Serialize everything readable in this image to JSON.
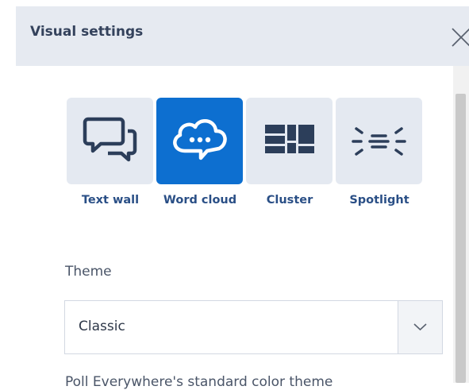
{
  "panel": {
    "title": "Visual settings",
    "close_icon": "close-icon"
  },
  "visual_types": [
    {
      "label": "Text wall",
      "icon": "speech-bubbles-icon",
      "selected": false
    },
    {
      "label": "Word cloud",
      "icon": "cloud-chat-icon",
      "selected": true
    },
    {
      "label": "Cluster",
      "icon": "cluster-blocks-icon",
      "selected": false
    },
    {
      "label": "Spotlight",
      "icon": "spotlight-icon",
      "selected": false
    }
  ],
  "theme": {
    "label": "Theme",
    "selected": "Classic",
    "dropdown_icon": "chevron-down-icon",
    "description": "Poll Everywhere's standard color theme"
  },
  "colors": {
    "accent": "#0d6fd0",
    "tile_bg": "#e4e9f1",
    "header_bg": "#e6eaf1",
    "label_color": "#2a4f86",
    "icon_dark": "#2c3e5a"
  }
}
